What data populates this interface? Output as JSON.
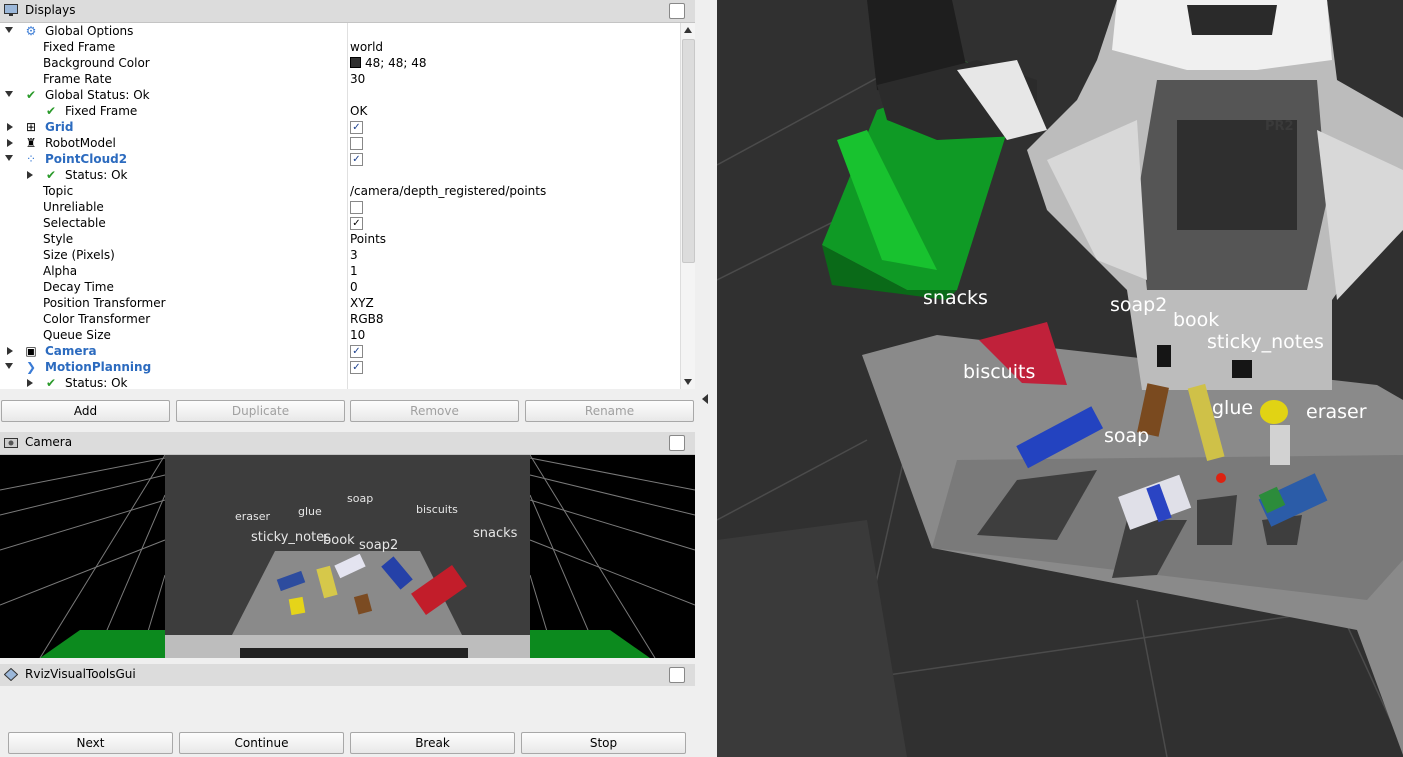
{
  "displays_panel": {
    "title": "Displays",
    "rows": [
      {
        "name": "Global Options",
        "value": ""
      },
      {
        "name": "Fixed Frame",
        "value": "world"
      },
      {
        "name": "Background Color",
        "value": "48; 48; 48"
      },
      {
        "name": "Frame Rate",
        "value": "30"
      },
      {
        "name": "Global Status: Ok",
        "value": ""
      },
      {
        "name": "Fixed Frame",
        "value": "OK"
      },
      {
        "name": "Grid",
        "value": ""
      },
      {
        "name": "RobotModel",
        "value": ""
      },
      {
        "name": "PointCloud2",
        "value": ""
      },
      {
        "name": "Status: Ok",
        "value": ""
      },
      {
        "name": "Topic",
        "value": "/camera/depth_registered/points"
      },
      {
        "name": "Unreliable",
        "value": ""
      },
      {
        "name": "Selectable",
        "value": ""
      },
      {
        "name": "Style",
        "value": "Points"
      },
      {
        "name": "Size (Pixels)",
        "value": "3"
      },
      {
        "name": "Alpha",
        "value": "1"
      },
      {
        "name": "Decay Time",
        "value": "0"
      },
      {
        "name": "Position Transformer",
        "value": "XYZ"
      },
      {
        "name": "Color Transformer",
        "value": "RGB8"
      },
      {
        "name": "Queue Size",
        "value": "10"
      },
      {
        "name": "Camera",
        "value": ""
      },
      {
        "name": "MotionPlanning",
        "value": ""
      },
      {
        "name": "Status: Ok",
        "value": ""
      }
    ],
    "checked": {
      "grid": true,
      "robotmodel": false,
      "pointcloud2": true,
      "unreliable": false,
      "selectable": true,
      "camera": true,
      "motionplanning": true
    },
    "buttons": {
      "add": "Add",
      "duplicate": "Duplicate",
      "remove": "Remove",
      "rename": "Rename"
    }
  },
  "camera_panel": {
    "title": "Camera",
    "labels": [
      "eraser",
      "glue",
      "soap",
      "biscuits",
      "sticky_notes",
      "book",
      "soap2",
      "snacks"
    ]
  },
  "rviz_tools_panel": {
    "title": "RvizVisualToolsGui",
    "buttons": {
      "next": "Next",
      "continue": "Continue",
      "break": "Break",
      "stop": "Stop"
    }
  },
  "viewport": {
    "labels": [
      "snacks",
      "soap2",
      "book",
      "sticky_notes",
      "biscuits",
      "glue",
      "eraser",
      "soap"
    ],
    "robot_logo": "PR2"
  },
  "colors": {
    "background": "#303030",
    "accent": "#2c6bbf",
    "ok": "#2a9a2a"
  }
}
